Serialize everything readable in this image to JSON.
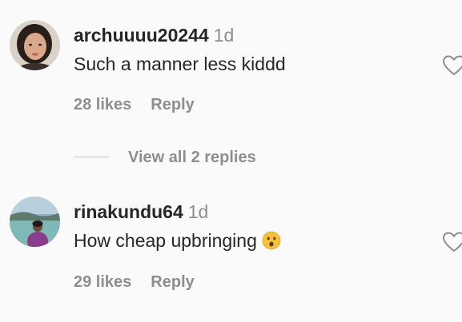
{
  "comments": [
    {
      "username": "archuuuu20244",
      "timestamp": "1d",
      "text": "Such a manner less kiddd",
      "likes": "28 likes",
      "reply_label": "Reply",
      "like_icon": "heart-outline-icon",
      "avatar": "profile-photo"
    },
    {
      "username": "rinakundu64",
      "timestamp": "1d",
      "text": "How cheap upbringing",
      "emoji": "hushed-face-emoji",
      "likes": "29 likes",
      "reply_label": "Reply",
      "like_icon": "heart-outline-icon",
      "avatar": "profile-photo"
    }
  ],
  "view_replies": {
    "label": "View all 2 replies"
  },
  "colors": {
    "background": "#fafafa",
    "primary_text": "#262626",
    "secondary_text": "#8e8e8e",
    "divider": "#c7c7c7"
  }
}
